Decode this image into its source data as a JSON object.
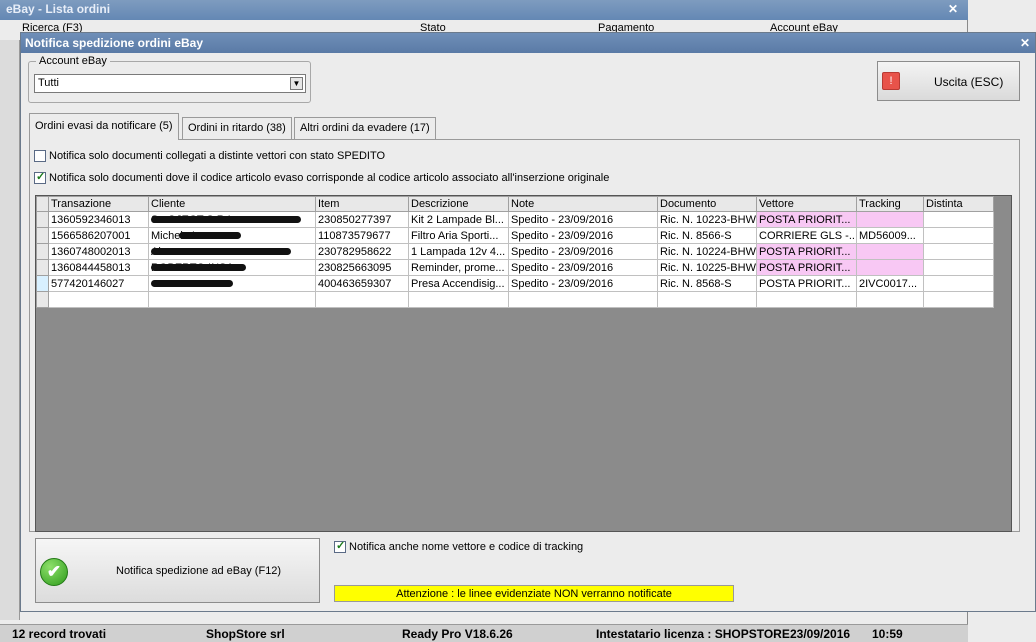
{
  "background_window": {
    "title": "eBay - Lista ordini",
    "close_glyph": "✕",
    "headers": [
      "Ricerca (F3)",
      "Stato",
      "Pagamento",
      "Account eBay"
    ],
    "status": [
      "12 record trovati",
      "ShopStore srl",
      "Ready Pro V18.6.26",
      "Intestatario licenza : SHOPSTORE",
      "23/09/2016",
      "10:59"
    ]
  },
  "dialog": {
    "title": "Notifica spedizione ordini eBay",
    "close_glyph": "✕",
    "account": {
      "legend": "Account eBay",
      "value": "Tutti",
      "arrow": "▼"
    },
    "exit_button": {
      "icon": "!",
      "label": "Uscita (ESC)"
    },
    "tabs": [
      {
        "label": "Ordini evasi da notificare (5)",
        "active": true
      },
      {
        "label": "Ordini in ritardo (38)",
        "active": false
      },
      {
        "label": "Altri ordini da evadere (17)",
        "active": false
      }
    ],
    "options": {
      "only_spedito": {
        "label": "Notifica solo documenti  collegati a distinte vettori con stato SPEDITO",
        "checked": false
      },
      "only_matching_code": {
        "label": "Notifica solo documenti dove il codice articolo evaso corrisponde al codice articolo associato all'inserzione originale",
        "checked": true
      }
    },
    "grid": {
      "columns": [
        "Transazione",
        "Cliente",
        "Item",
        "Descrizione",
        "Note",
        "Documento",
        "Vettore",
        "Tracking",
        "Distinta"
      ],
      "rows": [
        {
          "transazione": "1360592346013",
          "cliente": "S...OJECT S.R.L.",
          "item": "230850277397",
          "descrizione": "Kit 2 Lampade Bl...",
          "note": "Spedito - 23/09/2016",
          "documento": "Ric. N. 10223-BHW",
          "vettore": "POSTA PRIORIT...",
          "tracking": "",
          "distinta": "",
          "highlight": true
        },
        {
          "transazione": "1566586207001",
          "cliente": "Michele La...",
          "item": "110873579677",
          "descrizione": "Filtro Aria Sporti...",
          "note": "Spedito - 23/09/2016",
          "documento": "Ric. N. 8566-S",
          "vettore": "CORRIERE GLS -...",
          "tracking": "MD56009...",
          "distinta": "",
          "highlight": false
        },
        {
          "transazione": "1360748002013",
          "cliente": "Al...",
          "item": "230782958622",
          "descrizione": "1 Lampada 12v 4...",
          "note": "Spedito - 23/09/2016",
          "documento": "Ric. N. 10224-BHW",
          "vettore": "POSTA PRIORIT...",
          "tracking": "",
          "distinta": "",
          "highlight": true
        },
        {
          "transazione": "1360844458013",
          "cliente": "ROBERTO INSA...",
          "item": "230825663095",
          "descrizione": "Reminder, prome...",
          "note": "Spedito - 23/09/2016",
          "documento": "Ric. N. 10225-BHW",
          "vettore": "POSTA PRIORIT...",
          "tracking": "",
          "distinta": "",
          "highlight": true
        },
        {
          "transazione": "577420146027",
          "cliente": "",
          "item": "400463659307",
          "descrizione": "Presa Accendisig...",
          "note": "Spedito - 23/09/2016",
          "documento": "Ric. N. 8568-S",
          "vettore": "POSTA PRIORIT...",
          "tracking": "2IVC0017...",
          "distinta": "",
          "highlight": false
        }
      ]
    },
    "notify_button": {
      "icon": "✔",
      "label": "Notifica spedizione ad eBay (F12)"
    },
    "tracking_option": {
      "label": "Notifica anche nome vettore e codice di tracking",
      "checked": true
    },
    "warning": "Attenzione : le linee evidenziate NON verranno notificate",
    "colors": {
      "highlight": "#f8c8f4",
      "warning_bg": "#ffff00",
      "titlebar": "#5a7aa6"
    }
  }
}
